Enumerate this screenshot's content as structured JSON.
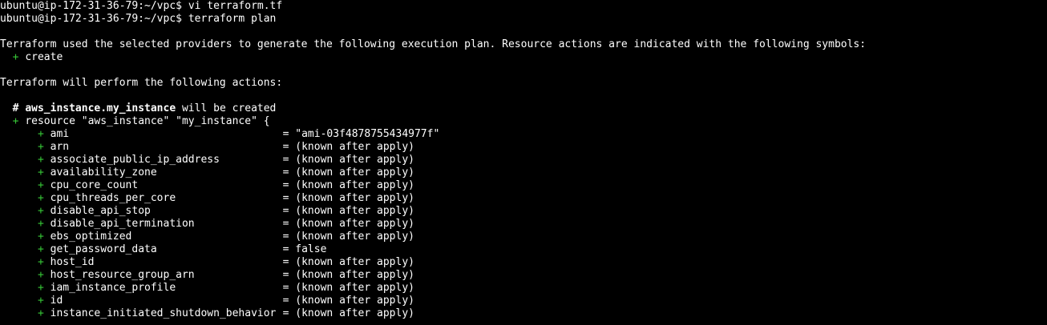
{
  "terminal": {
    "bg": "#000000",
    "fg": "#ffffff",
    "plus_color": "#37c837",
    "prompt": "ubuntu@ip-172-31-36-79:~/vpc$",
    "commands": [
      "vi terraform.tf",
      "terraform plan"
    ],
    "intro_line": "Terraform used the selected providers to generate the following execution plan. Resource actions are indicated with the following symbols:",
    "symbol_plus": "+",
    "symbol_create": "create",
    "actions_line": "Terraform will perform the following actions:",
    "resource_comment_hash": "#",
    "resource_address": "aws_instance.my_instance",
    "resource_will_be_created": "will be created",
    "resource_decl": "resource \"aws_instance\" \"my_instance\" {",
    "attributes": [
      {
        "name": "ami",
        "value": "= \"ami-03f4878755434977f\""
      },
      {
        "name": "arn",
        "value": "= (known after apply)"
      },
      {
        "name": "associate_public_ip_address",
        "value": "= (known after apply)"
      },
      {
        "name": "availability_zone",
        "value": "= (known after apply)"
      },
      {
        "name": "cpu_core_count",
        "value": "= (known after apply)"
      },
      {
        "name": "cpu_threads_per_core",
        "value": "= (known after apply)"
      },
      {
        "name": "disable_api_stop",
        "value": "= (known after apply)"
      },
      {
        "name": "disable_api_termination",
        "value": "= (known after apply)"
      },
      {
        "name": "ebs_optimized",
        "value": "= (known after apply)"
      },
      {
        "name": "get_password_data",
        "value": "= false"
      },
      {
        "name": "host_id",
        "value": "= (known after apply)"
      },
      {
        "name": "host_resource_group_arn",
        "value": "= (known after apply)"
      },
      {
        "name": "iam_instance_profile",
        "value": "= (known after apply)"
      },
      {
        "name": "id",
        "value": "= (known after apply)"
      },
      {
        "name": "instance_initiated_shutdown_behavior",
        "value": "= (known after apply)"
      }
    ]
  }
}
